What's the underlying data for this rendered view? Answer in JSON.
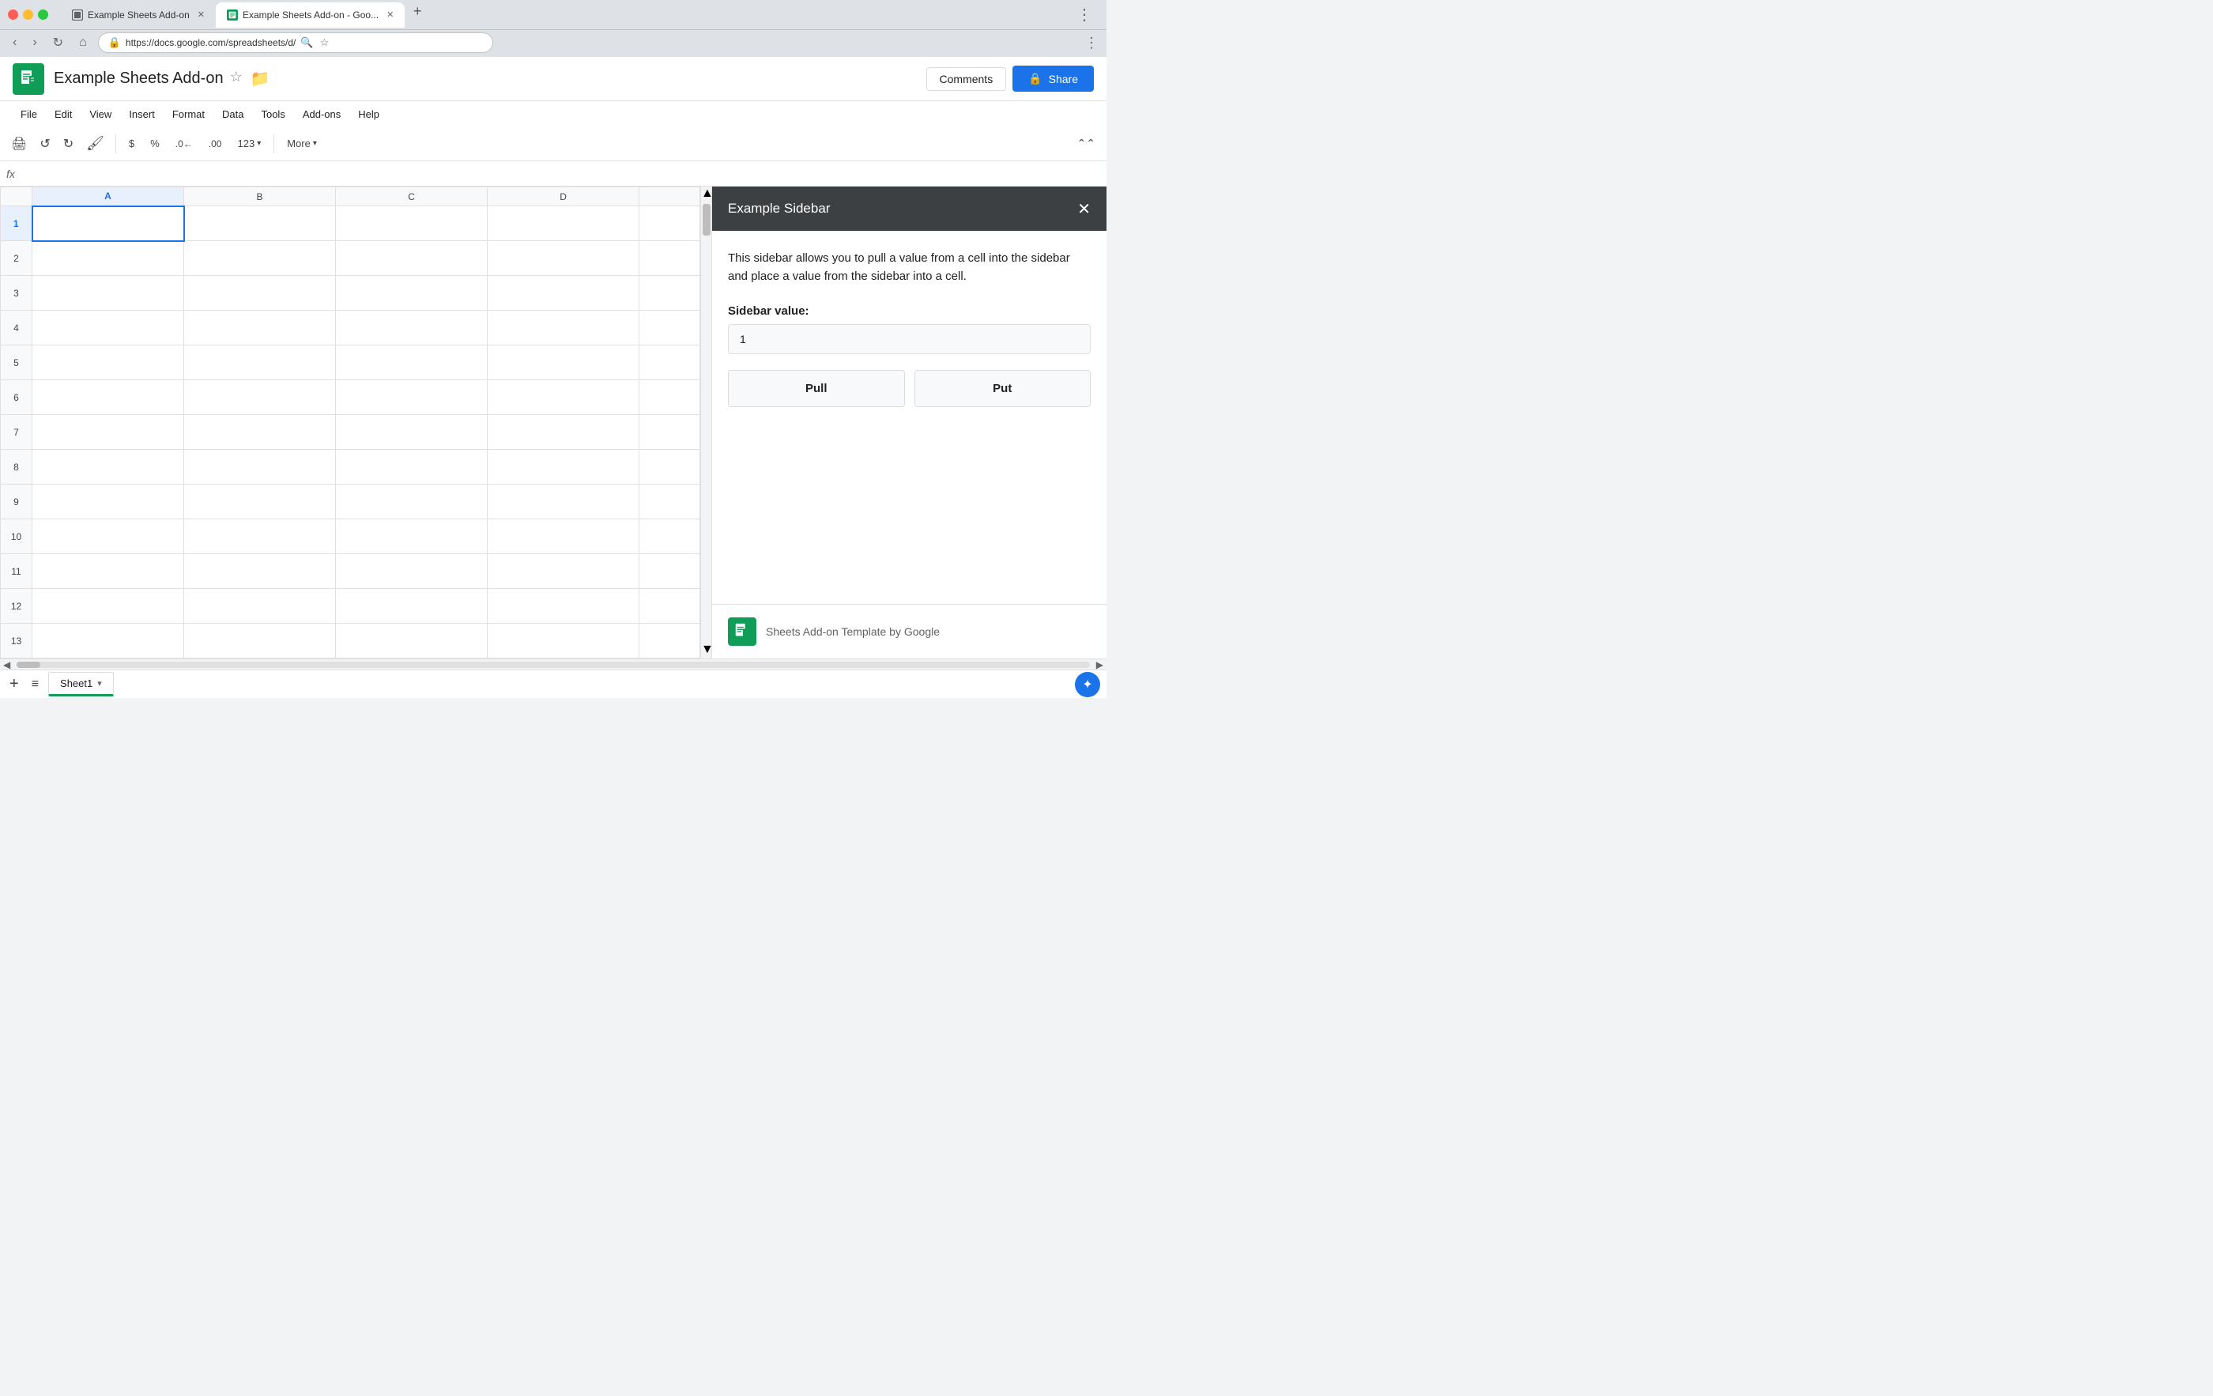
{
  "browser": {
    "tabs": [
      {
        "label": "Example Sheets Add-on",
        "active": false,
        "iconColor": "#5f6368"
      },
      {
        "label": "Example Sheets Add-on - Goo...",
        "active": true,
        "iconColor": "#0f9d58"
      }
    ],
    "url": "https://docs.google.com/spreadsheets/d/",
    "nav": {
      "back": "←",
      "forward": "→",
      "refresh": "↺",
      "home": "⌂"
    }
  },
  "header": {
    "title": "Example Sheets Add-on",
    "star_icon": "☆",
    "folder_icon": "🗁",
    "comments_label": "Comments",
    "share_label": "Share",
    "lock_icon": "🔒"
  },
  "menu": {
    "items": [
      "File",
      "Edit",
      "View",
      "Insert",
      "Format",
      "Data",
      "Tools",
      "Add-ons",
      "Help"
    ]
  },
  "toolbar": {
    "print": "🖨",
    "undo": "↺",
    "redo": "↻",
    "paint": "🖌",
    "currency": "$",
    "percent": "%",
    "decrease_decimal": ".0←",
    "increase_decimal": ".00",
    "format_123": "123",
    "more_label": "More",
    "collapse_icon": "⌃⌃"
  },
  "formula_bar": {
    "fx_label": "fx"
  },
  "spreadsheet": {
    "columns": [
      "A",
      "B",
      "C",
      "D"
    ],
    "rows": [
      1,
      2,
      3,
      4,
      5,
      6,
      7,
      8,
      9,
      10,
      11,
      12,
      13
    ],
    "selected_cell": "A1"
  },
  "sidebar": {
    "title": "Example Sidebar",
    "close_icon": "✕",
    "description": "This sidebar allows you to pull a value from a cell into the sidebar and place a value from the sidebar into a cell.",
    "value_label": "Sidebar value:",
    "input_value": "1",
    "pull_label": "Pull",
    "put_label": "Put",
    "footer_text": "Sheets Add-on Template by Google"
  },
  "sheet_tabs": {
    "add_icon": "+",
    "list_icon": "≡",
    "tab_label": "Sheet1",
    "tab_arrow": "▾",
    "explore_icon": "✦"
  }
}
